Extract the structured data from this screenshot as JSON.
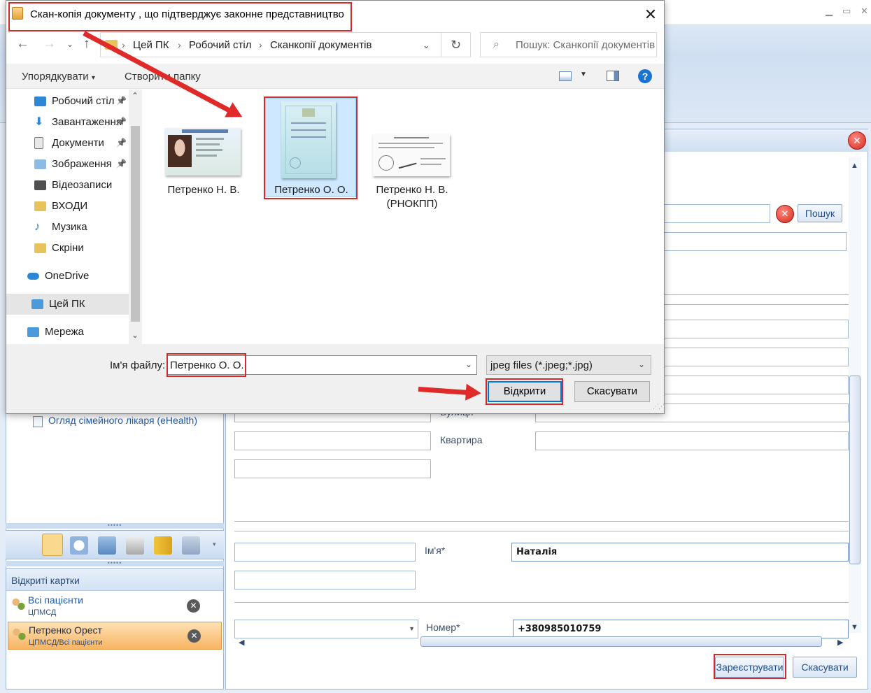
{
  "dialog": {
    "title": "Скан-копія документу , що підтверджує законне представництво",
    "close": "✕",
    "breadcrumbs": [
      "Цей ПК",
      "Робочий стіл",
      "Сканкопії документів"
    ],
    "search_placeholder": "Пошук: Сканкопії документів",
    "commands": {
      "organize": "Упорядкувати",
      "new_folder": "Створити папку"
    },
    "nav_items": [
      {
        "label": "Робочий стіл",
        "icon": "desktop-icon",
        "pinned": true
      },
      {
        "label": "Завантаження",
        "icon": "download-icon",
        "pinned": true
      },
      {
        "label": "Документи",
        "icon": "documents-icon",
        "pinned": true
      },
      {
        "label": "Зображення",
        "icon": "pictures-icon",
        "pinned": true
      },
      {
        "label": "Відеозаписи",
        "icon": "videos-icon",
        "pinned": false
      },
      {
        "label": "ВХОДИ",
        "icon": "folder-icon",
        "pinned": false
      },
      {
        "label": "Музика",
        "icon": "music-icon",
        "pinned": false
      },
      {
        "label": "Скріни",
        "icon": "folder-icon",
        "pinned": false
      },
      {
        "label": "OneDrive",
        "icon": "onedrive-icon",
        "pinned": false
      },
      {
        "label": "Цей ПК",
        "icon": "computer-icon",
        "pinned": false,
        "selected": true
      },
      {
        "label": "Мережа",
        "icon": "network-icon",
        "pinned": false
      }
    ],
    "files": [
      {
        "name": "Петренко Н. В.",
        "kind": "id-card"
      },
      {
        "name": "Петренко О. О.",
        "kind": "certificate",
        "selected": true
      },
      {
        "name": "Петренко Н. В. (РНОКПП)",
        "kind": "tax-doc"
      }
    ],
    "filename_label": "Ім'я файлу:",
    "filename_value": "Петренко О. О.",
    "filetype_value": "jpeg files (*.jpeg;*.jpg)",
    "open_label": "Відкрити",
    "cancel_label": "Скасувати"
  },
  "app": {
    "left_panel": {
      "tree_item": "Огляд сімейного лікаря (eHealth)"
    },
    "open_cards": {
      "title": "Відкриті картки",
      "cards": [
        {
          "name": "Всі пацієнти",
          "sub": "ЦПМСД",
          "active": false
        },
        {
          "name": "Петренко Орест",
          "sub": "ЦПМСД/Всі пацієнти",
          "active": true
        }
      ]
    },
    "form": {
      "search_button": "Пошук",
      "labels": {
        "street": "Вулиця",
        "apartment": "Квартира",
        "first_name": "Ім'я*",
        "number": "Номер*"
      },
      "first_name_value": "Наталія",
      "phone_value": "+380985010759",
      "register_button": "Зареєструвати",
      "cancel_button": "Скасувати"
    }
  },
  "colors": {
    "annotation": "#d42a2a",
    "accent": "#0078d7"
  }
}
